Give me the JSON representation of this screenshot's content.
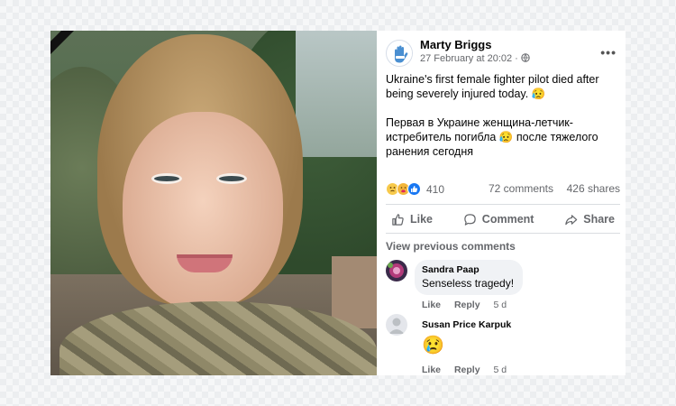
{
  "post": {
    "author": "Marty Briggs",
    "timestamp": "27 February at 20:02 ·",
    "more_label": "•••",
    "text_en": "Ukraine's first female fighter pilot died after being severely injured today. 😥",
    "text_ru": "Первая в Украине женщина-летчик-истребитель погибла 😥 после тяжелого ранения сегодня"
  },
  "stats": {
    "reaction_icons": [
      "sad-reaction-icon",
      "care-reaction-icon",
      "like-reaction-icon"
    ],
    "reactions_count": "410",
    "comments_count": "72 comments",
    "shares_count": "426 shares"
  },
  "actions": {
    "like_label": "Like",
    "comment_label": "Comment",
    "share_label": "Share"
  },
  "comments": {
    "view_previous": "View previous comments",
    "items": [
      {
        "name": "Sandra Paap",
        "text": "Senseless tragedy!",
        "like": "Like",
        "reply": "Reply",
        "time": "5 d"
      },
      {
        "name": "Susan Price Karpuk",
        "text": "😢",
        "like": "Like",
        "reply": "Reply",
        "time": "5 d"
      }
    ]
  },
  "colors": {
    "link_blue": "#1877f2",
    "meta_gray": "#65676b",
    "bubble_bg": "#f0f2f5"
  }
}
